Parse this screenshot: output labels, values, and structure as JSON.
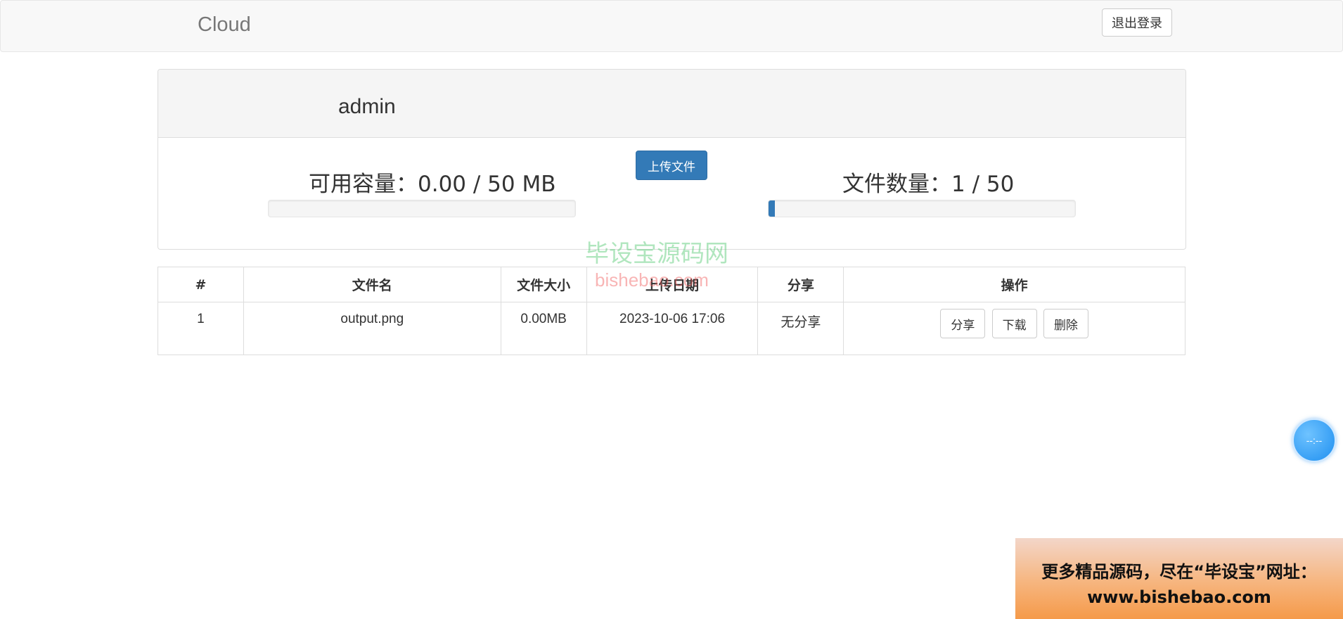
{
  "navbar": {
    "brand": "Cloud",
    "logout_label": "退出登录"
  },
  "user": {
    "name": "admin"
  },
  "upload_label": "上传文件",
  "stats": {
    "capacity_label": "可用容量：0.00 / 50 MB",
    "capacity_fraction": 0.0,
    "count_label": "文件数量：1 / 50",
    "count_fraction": 0.02
  },
  "table": {
    "headers": [
      "#",
      "文件名",
      "文件大小",
      "上传日期",
      "分享",
      "操作"
    ],
    "rows": [
      {
        "index": "1",
        "name": "output.png",
        "size": "0.00MB",
        "date": "2023-10-06 17:06",
        "share": "无分享"
      }
    ],
    "actions": {
      "share": "分享",
      "download": "下载",
      "delete": "删除"
    }
  },
  "watermark": {
    "cn": "毕设宝源码网",
    "en": "bishebao.com"
  },
  "float_button": {
    "text": "--:--"
  },
  "ad": {
    "line1": "更多精品源码，尽在“毕设宝”网址：",
    "line2": "www.bishebao.com"
  },
  "colors": {
    "primary": "#337ab7",
    "brand_text": "#777777"
  }
}
